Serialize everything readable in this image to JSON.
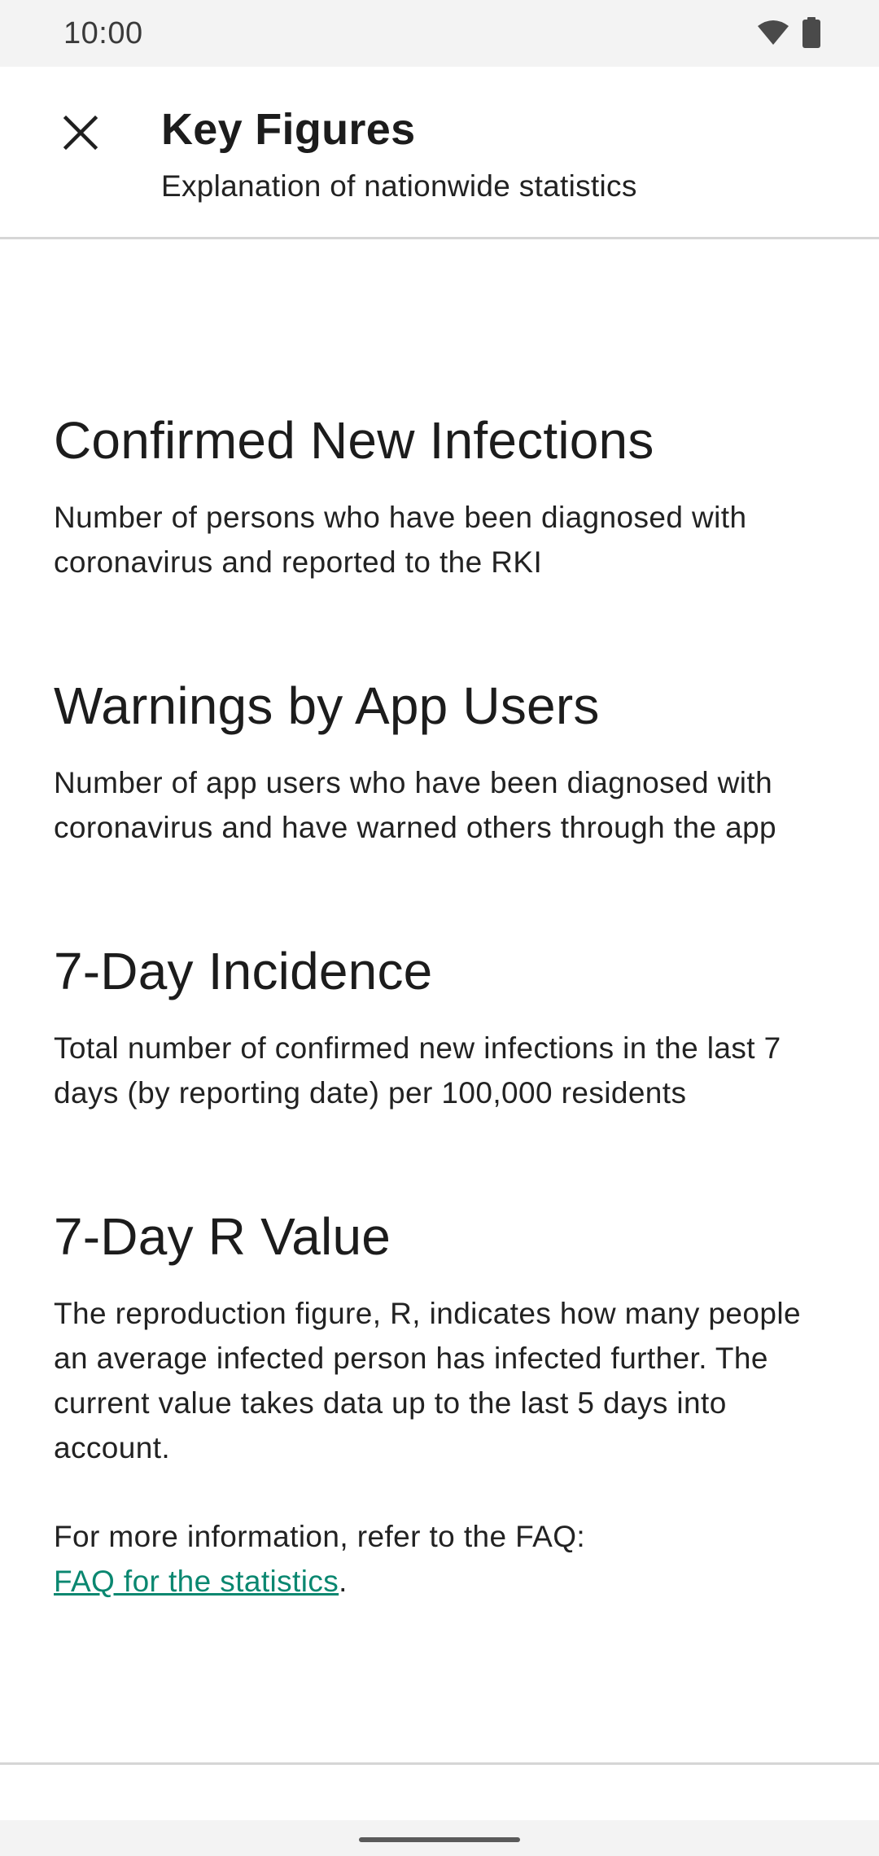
{
  "status_bar": {
    "time": "10:00",
    "icons": [
      "wifi-icon",
      "battery-icon"
    ]
  },
  "toolbar": {
    "close_icon": "close-icon",
    "title": "Key Figures",
    "subtitle": "Explanation of nationwide statistics"
  },
  "sections": [
    {
      "title": "Confirmed New Infections",
      "body": "Number of persons who have been diagnosed with coronavirus and reported to the RKI"
    },
    {
      "title": "Warnings by App Users",
      "body": "Number of app users who have been diagnosed with coronavirus and have warned others through the app"
    },
    {
      "title": "7-Day Incidence",
      "body": "Total number of confirmed new infections in the last 7 days (by reporting date) per 100,000 residents"
    },
    {
      "title": "7-Day R Value",
      "body": "The reproduction figure, R, indicates how many people an average infected person has infected further. The current value takes data up to the last 5 days into account."
    }
  ],
  "faq": {
    "intro": "For more information, refer to the FAQ:",
    "link_label": "FAQ for the statistics",
    "suffix": "."
  },
  "colors": {
    "link": "#0a8770",
    "status_bar_bg": "#f3f3f3",
    "divider": "#d6d6d6"
  }
}
